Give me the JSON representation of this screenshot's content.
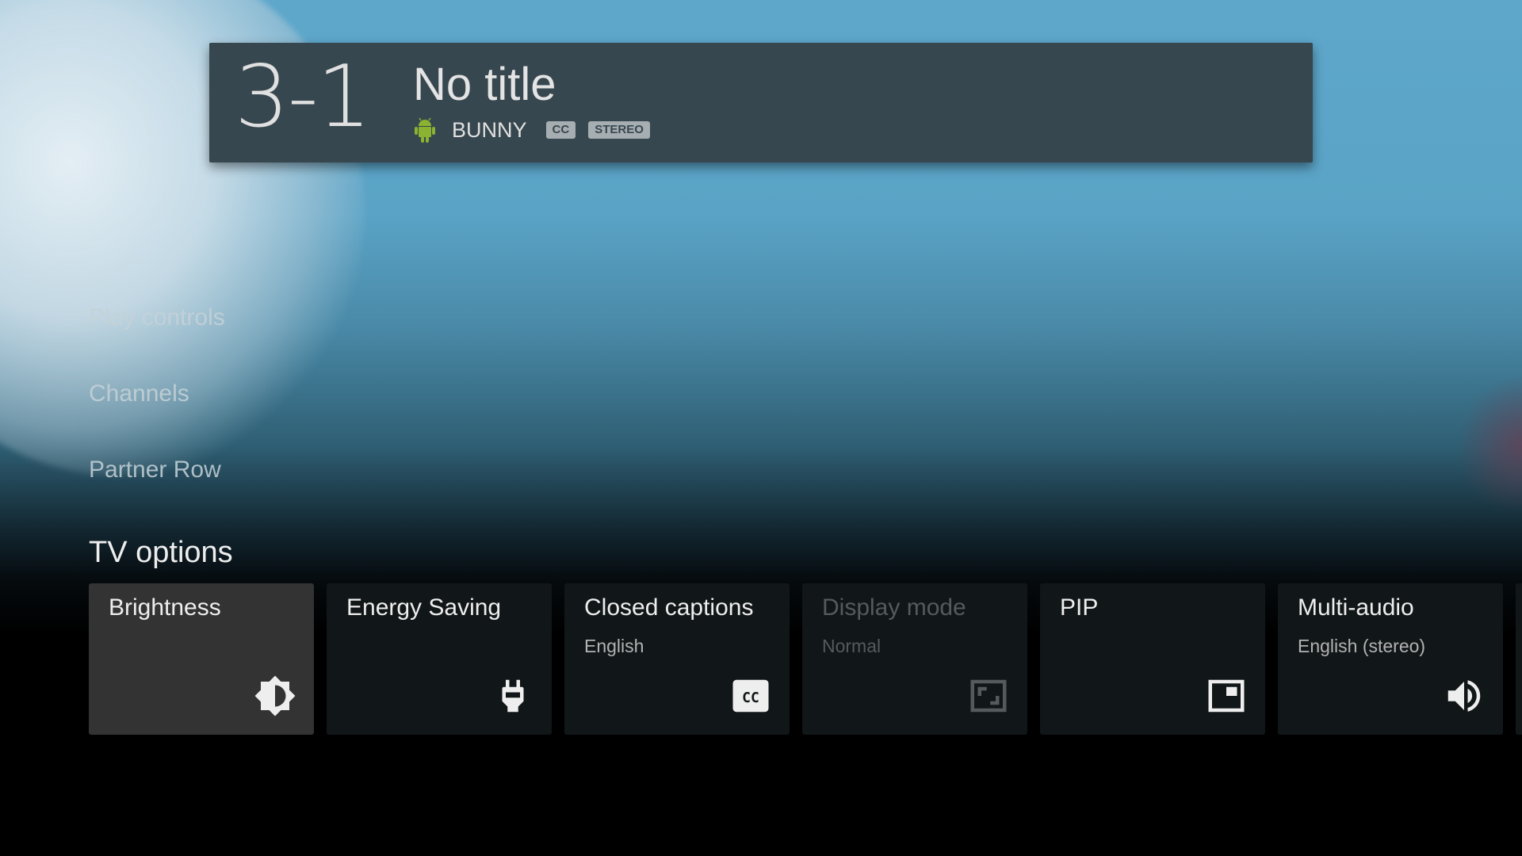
{
  "banner": {
    "channel_number": "3-1",
    "program_title": "No title",
    "channel_name": "BUNNY",
    "channel_logo_icon": "android-icon",
    "badges": [
      "CC",
      "STEREO"
    ]
  },
  "side_menu": {
    "items": [
      {
        "label": "Play controls"
      },
      {
        "label": "Channels"
      },
      {
        "label": "Partner Row"
      }
    ]
  },
  "tv_options": {
    "title": "TV options",
    "focused_index": 0,
    "cards": [
      {
        "title": "Brightness",
        "subtitle": "",
        "icon": "brightness-icon",
        "enabled": true
      },
      {
        "title": "Energy Saving",
        "subtitle": "",
        "icon": "power-plug-icon",
        "enabled": true
      },
      {
        "title": "Closed captions",
        "subtitle": "English",
        "icon": "closed-captions-icon",
        "enabled": true
      },
      {
        "title": "Display mode",
        "subtitle": "Normal",
        "icon": "display-mode-icon",
        "enabled": false
      },
      {
        "title": "PIP",
        "subtitle": "",
        "icon": "picture-in-picture-icon",
        "enabled": true
      },
      {
        "title": "Multi-audio",
        "subtitle": "English (stereo)",
        "icon": "volume-icon",
        "enabled": true
      }
    ]
  },
  "colors": {
    "banner_bg": "#37474f",
    "card_bg": "#111618",
    "card_focused_bg": "#333333",
    "android_green": "#8bb230"
  }
}
